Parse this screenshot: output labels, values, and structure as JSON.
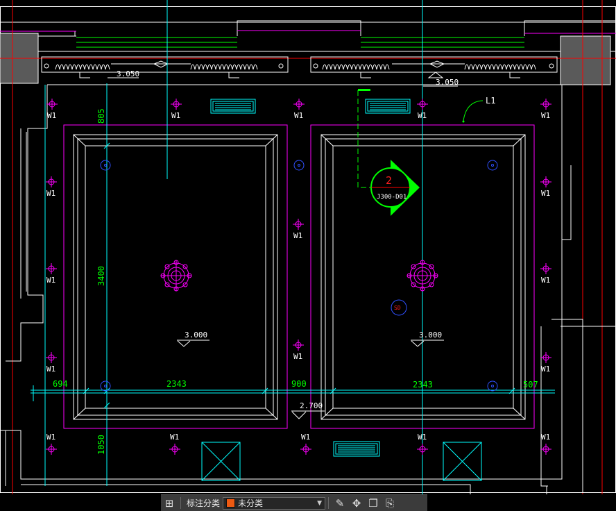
{
  "drawing": {
    "dim": {
      "top_805": "805",
      "left_3400": "3400",
      "bottom_1050": "1050",
      "w_694": "694",
      "w_2343_left": "2343",
      "w_900": "900",
      "w_2343_right": "2343",
      "w_507": "507"
    },
    "elev": {
      "e_3050_left": "3.050",
      "e_3050_right": "3.050",
      "e_3000_left": "3.000",
      "e_3000_right": "3.000",
      "e_2700": "2.700"
    },
    "fixture_label": "W1",
    "leader_label": "L1",
    "section_number": "2",
    "section_sheet": "J300-D01",
    "sd_label": "SD"
  },
  "toolbar": {
    "category_label": "标注分类",
    "selected_category": "未分类",
    "swatch_color": "#ee5a12"
  },
  "colors": {
    "white": "#ffffff",
    "magenta": "#ff00ff",
    "cyan": "#00ffff",
    "green": "#00ff00",
    "red": "#ff0000",
    "blue": "#0000ff",
    "yellow": "#ffff00"
  }
}
